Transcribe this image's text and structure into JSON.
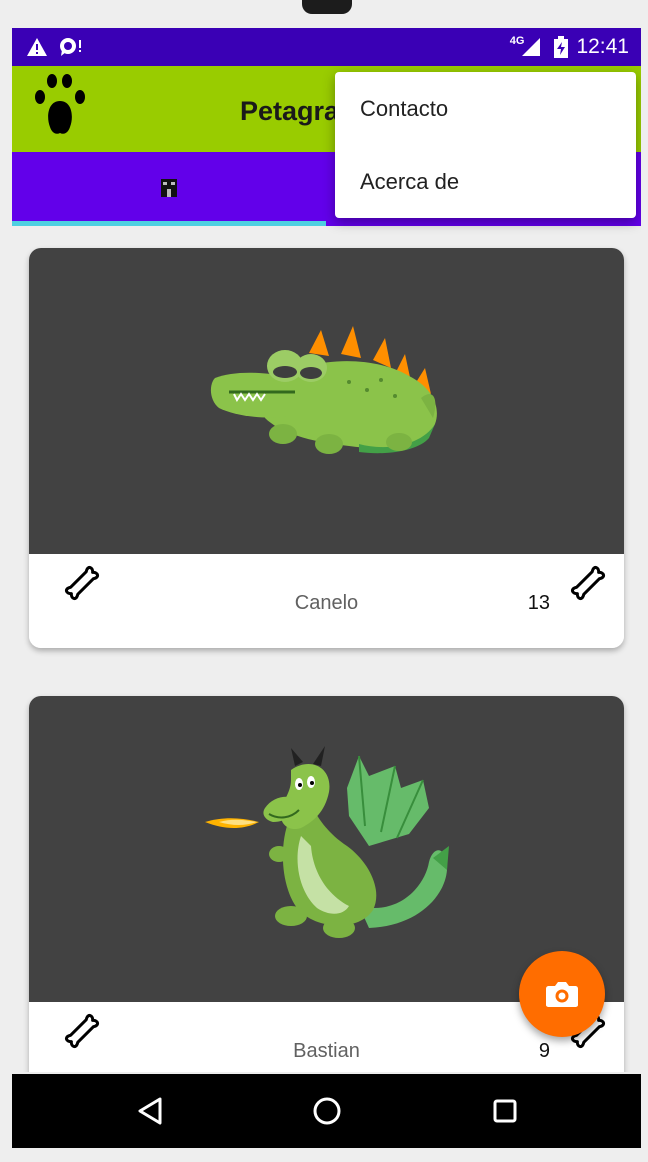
{
  "status_bar": {
    "network_label": "4G",
    "time": "12:41",
    "icons": [
      "warning-icon",
      "notification-icon",
      "signal-icon",
      "battery-charging-icon"
    ]
  },
  "app_bar": {
    "title": "Petagram",
    "logo_icon": "paw-icon"
  },
  "tabs": {
    "items": [
      {
        "icon": "home-icon",
        "selected": true
      }
    ],
    "indicator_color": "#4dd0e1"
  },
  "overflow_menu": {
    "items": [
      {
        "label": "Contacto"
      },
      {
        "label": "Acerca de"
      }
    ]
  },
  "pets": [
    {
      "name": "Canelo",
      "likes": "13",
      "image": "crocodile-image",
      "like_icon": "bone-icon",
      "rating_icon": "bone-icon"
    },
    {
      "name": "Bastian",
      "likes": "9",
      "image": "dragon-image",
      "like_icon": "bone-icon",
      "rating_icon": "bone-icon"
    }
  ],
  "fab": {
    "icon": "camera-icon",
    "color": "#ff6d00"
  },
  "nav_bar": {
    "icons": [
      "back-icon",
      "home-circle-icon",
      "recents-icon"
    ]
  },
  "colors": {
    "status_bar": "#3a00b5",
    "app_bar": "#99cc00",
    "tab_bar": "#6200ea",
    "card_image_bg": "#424242",
    "background": "#eeeeee"
  }
}
